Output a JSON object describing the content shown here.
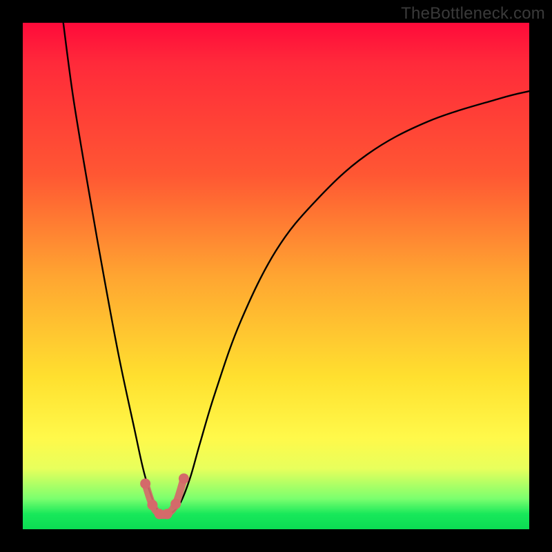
{
  "watermark": "TheBottleneck.com",
  "chart_data": {
    "type": "line",
    "title": "",
    "xlabel": "",
    "ylabel": "",
    "xlim": [
      0,
      100
    ],
    "ylim": [
      0,
      100
    ],
    "series": [
      {
        "name": "bottleneck-curve",
        "x": [
          8,
          10,
          13,
          16,
          19,
          22,
          24,
          26,
          27.5,
          29,
          31,
          33,
          35,
          38,
          43,
          50,
          58,
          68,
          80,
          94,
          100
        ],
        "values": [
          100,
          85,
          67,
          50,
          34,
          20,
          11,
          5,
          3,
          3,
          5,
          10,
          17,
          27,
          41,
          55,
          65,
          74,
          80.5,
          85,
          86.5
        ]
      }
    ],
    "markers": {
      "name": "trough-markers",
      "color": "#d46a6a",
      "x": [
        24.2,
        25.6,
        27.0,
        28.5,
        30.2,
        31.8
      ],
      "values": [
        9.0,
        4.8,
        3.0,
        3.0,
        5.0,
        10.0
      ]
    }
  }
}
